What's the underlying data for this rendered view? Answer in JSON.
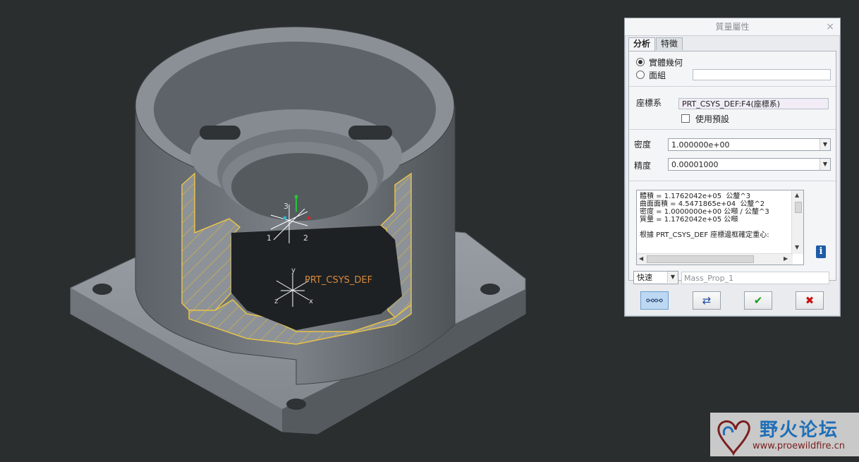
{
  "viewport": {
    "csys_label": "PRT_CSYS_DEF",
    "axis_label_1": "1",
    "axis_label_2": "2",
    "axis_label_3": "3",
    "axis_label_x": "x",
    "axis_label_y": "y",
    "axis_label_z": "z"
  },
  "dialog": {
    "title": "質量屬性",
    "close_icon": "close-icon",
    "tabs": [
      {
        "label": "分析",
        "active": true
      },
      {
        "label": "特徵",
        "active": false
      }
    ],
    "radio_solid": "實體幾何",
    "radio_quilt": "面組",
    "csys_label": "座標系",
    "csys_value": "PRT_CSYS_DEF:F4(座標系)",
    "use_default": "使用預設",
    "density_label": "密度",
    "density_value": "1.000000e+00",
    "accuracy_label": "精度",
    "accuracy_value": "0.00001000",
    "results": {
      "line1": "體積 = 1.1762042e+05  公釐^3",
      "line2": "曲面面積 = 4.5471865e+04  公釐^2",
      "line3": "密度 = 1.0000000e+00 公噸 / 公釐^3",
      "line4": "質量 = 1.1762042e+05 公噸",
      "line5": "根據 PRT_CSYS_DEF 座標邊框確定重心:"
    },
    "mode_value": "快速",
    "name_value": "Mass_Prop_1",
    "buttons": {
      "preview_icon": "glasses-icon",
      "repaint_icon": "refresh-icon",
      "ok_icon": "check-icon",
      "cancel_icon": "x-icon"
    },
    "colors": {
      "ok": "#1a9a1a",
      "cancel": "#cc1111",
      "info": "#1f5ca8"
    }
  },
  "watermark": {
    "title": "野火论坛",
    "url": "www.proewildfire.cn"
  }
}
